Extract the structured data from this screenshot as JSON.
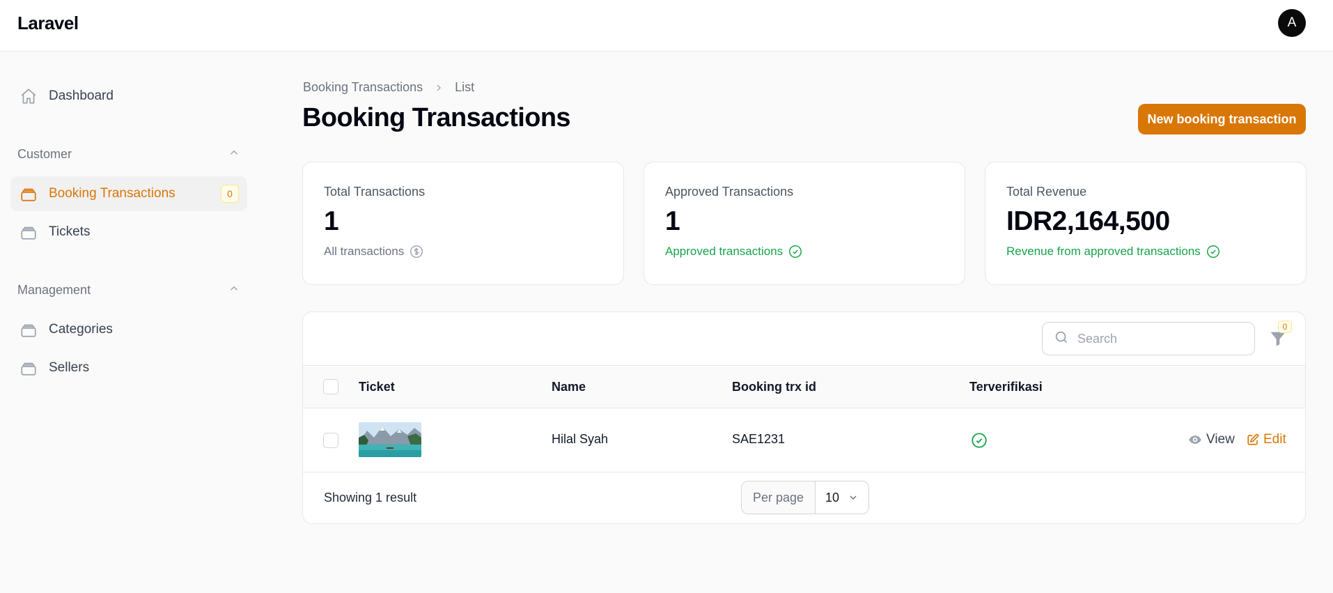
{
  "app": {
    "brand": "Laravel",
    "avatar_initial": "A"
  },
  "sidebar": {
    "dashboard": "Dashboard",
    "group_customer": "Customer",
    "booking_transactions": "Booking Transactions",
    "booking_badge": "0",
    "tickets": "Tickets",
    "group_management": "Management",
    "categories": "Categories",
    "sellers": "Sellers"
  },
  "breadcrumb": {
    "parent": "Booking Transactions",
    "current": "List"
  },
  "page": {
    "title": "Booking Transactions",
    "new_button": "New booking transaction"
  },
  "stats": [
    {
      "label": "Total Transactions",
      "value": "1",
      "desc": "All transactions"
    },
    {
      "label": "Approved Transactions",
      "value": "1",
      "desc": "Approved transactions"
    },
    {
      "label": "Total Revenue",
      "value": "IDR2,164,500",
      "desc": "Revenue from approved transactions"
    }
  ],
  "table": {
    "search_placeholder": "Search",
    "filter_count": "0",
    "columns": [
      "Ticket",
      "Name",
      "Booking trx id",
      "Terverifikasi"
    ],
    "rows": [
      {
        "name": "Hilal Syah",
        "trx_id": "SAE1231",
        "verified": true,
        "view": "View",
        "edit": "Edit"
      }
    ],
    "footer_text": "Showing 1 result",
    "per_page_label": "Per page",
    "per_page_value": "10"
  },
  "colors": {
    "accent": "#d97706",
    "success": "#16a34a",
    "muted": "#6b7280"
  }
}
